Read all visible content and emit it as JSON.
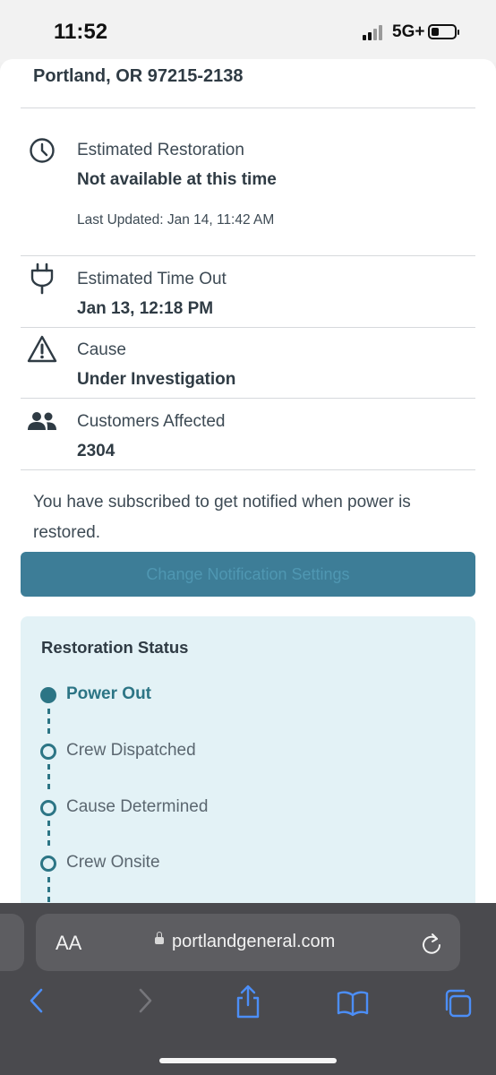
{
  "status_bar": {
    "time": "11:52",
    "network": "5G+"
  },
  "location": {
    "address": "Portland, OR 97215-2138"
  },
  "restoration": {
    "label": "Estimated Restoration",
    "value": "Not available at this time",
    "last_updated": "Last Updated: Jan 14, 11:42 AM"
  },
  "time_out": {
    "label": "Estimated Time Out",
    "value": "Jan 13, 12:18 PM"
  },
  "cause": {
    "label": "Cause",
    "value": "Under Investigation"
  },
  "customers": {
    "label": "Customers Affected",
    "value": "2304"
  },
  "notice": "You have subscribed to get notified when power is restored.",
  "button": {
    "label": "Change Notification Settings"
  },
  "status": {
    "title": "Restoration Status",
    "steps": [
      {
        "label": "Power Out",
        "active": true
      },
      {
        "label": "Crew Dispatched",
        "active": false
      },
      {
        "label": "Cause Determined",
        "active": false
      },
      {
        "label": "Crew Onsite",
        "active": false
      }
    ]
  },
  "browser": {
    "text_size_label": "AA",
    "url": "portlandgeneral.com"
  },
  "colors": {
    "accent": "#2c7585",
    "button": "#3d7d97",
    "card": "#e3f2f6"
  },
  "icons": [
    "clock-icon",
    "plug-icon",
    "warning-icon",
    "people-icon",
    "lock-icon",
    "reload-icon",
    "back-icon",
    "forward-icon",
    "share-icon",
    "bookmarks-icon",
    "tabs-icon"
  ]
}
